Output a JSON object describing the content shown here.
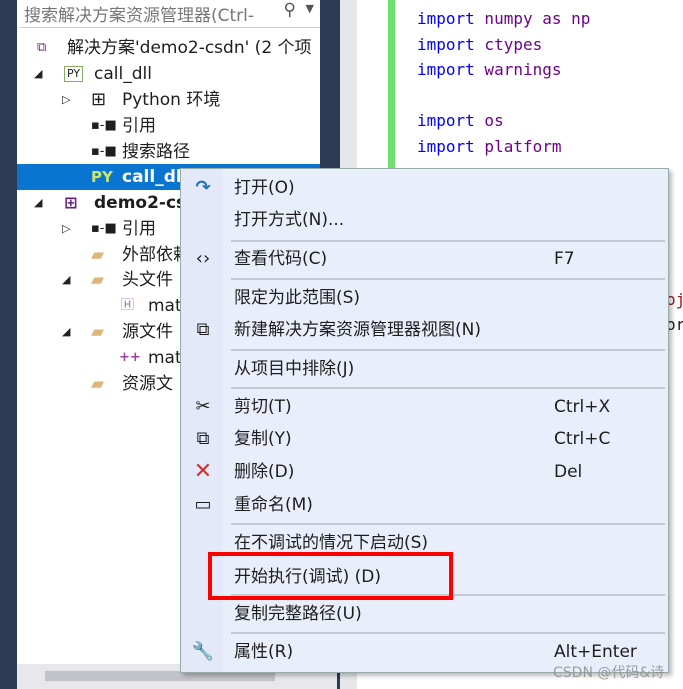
{
  "explorer": {
    "search_placeholder": "搜索解决方案资源管理器(Ctrl-",
    "items": [
      {
        "label": "解决方案'demo2-csdn' (2 个项",
        "icon": "visual-studio-solution-icon"
      },
      {
        "label": "call_dll",
        "icon": "python-project-icon"
      },
      {
        "label": "Python 环境",
        "icon": "python-environment-icon"
      },
      {
        "label": "引用",
        "icon": "reference-icon"
      },
      {
        "label": "搜索路径",
        "icon": "search-path-icon"
      },
      {
        "label": "call_dll",
        "icon": "python-file-icon"
      },
      {
        "label": "demo2-cs",
        "icon": "cpp-project-icon"
      },
      {
        "label": "引用",
        "icon": "reference-icon"
      },
      {
        "label": "外部依赖",
        "icon": "external-dependencies-icon"
      },
      {
        "label": "头文件",
        "icon": "filter-folder-icon"
      },
      {
        "label": "mat",
        "icon": "header-file-icon"
      },
      {
        "label": "源文件",
        "icon": "filter-folder-icon"
      },
      {
        "label": "mat",
        "icon": "cpp-file-icon"
      },
      {
        "label": "资源文",
        "icon": "filter-folder-icon"
      }
    ]
  },
  "editor": {
    "lines": [
      {
        "kw": "import",
        "rest": " numpy as np"
      },
      {
        "kw": "import",
        "rest": " ctypes"
      },
      {
        "kw": "import",
        "rest": " warnings"
      },
      {
        "kw": "import",
        "rest": " os"
      },
      {
        "kw": "import",
        "rest": " platform"
      }
    ],
    "fragments": [
      "oj",
      "or"
    ]
  },
  "menu": {
    "items": [
      {
        "label": "打开(O)",
        "shortcut": "",
        "icon": "open-arrow-icon"
      },
      {
        "label": "打开方式(N)...",
        "shortcut": ""
      },
      {
        "label": "查看代码(C)",
        "shortcut": "F7",
        "icon": "code-brackets-icon"
      },
      {
        "label": "限定为此范围(S)",
        "shortcut": ""
      },
      {
        "label": "新建解决方案资源管理器视图(N)",
        "shortcut": "",
        "icon": "new-view-icon"
      },
      {
        "label": "从项目中排除(J)",
        "shortcut": ""
      },
      {
        "label": "剪切(T)",
        "shortcut": "Ctrl+X",
        "icon": "scissors-icon"
      },
      {
        "label": "复制(Y)",
        "shortcut": "Ctrl+C",
        "icon": "copy-icon"
      },
      {
        "label": "删除(D)",
        "shortcut": "Del",
        "icon": "delete-x-icon"
      },
      {
        "label": "重命名(M)",
        "shortcut": "",
        "icon": "rename-icon"
      },
      {
        "label": "在不调试的情况下启动(S)",
        "shortcut": ""
      },
      {
        "label": "开始执行(调试) (D)",
        "shortcut": ""
      },
      {
        "label": "复制完整路径(U)",
        "shortcut": ""
      },
      {
        "label": "属性(R)",
        "shortcut": "Alt+Enter",
        "icon": "wrench-icon"
      }
    ]
  },
  "highlight_color": "#ff0000",
  "watermark": "CSDN @代码&诗"
}
